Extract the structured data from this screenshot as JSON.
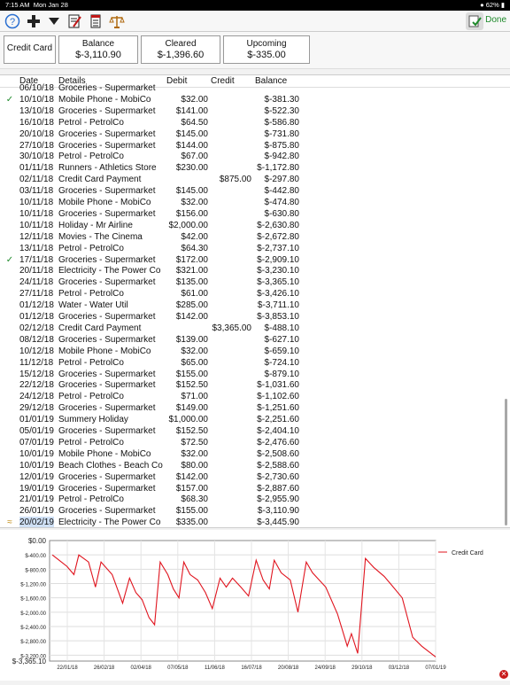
{
  "status": {
    "time": "7:15 AM",
    "date": "Mon Jan 28",
    "battery": "62%"
  },
  "toolbar": {
    "icons": [
      "help-icon",
      "add-icon",
      "filter-icon",
      "edit-icon",
      "report-icon",
      "balance-scale-icon"
    ],
    "done_label": "Done"
  },
  "summary": {
    "account": "Credit Card",
    "balance_label": "Balance",
    "balance": "$-3,110.90",
    "cleared_label": "Cleared",
    "cleared": "$-1,396.60",
    "upcoming_label": "Upcoming",
    "upcoming": "$-335.00"
  },
  "columns": {
    "date": "Date",
    "details": "Details",
    "debit": "Debit",
    "credit": "Credit",
    "balance": "Balance"
  },
  "rows": [
    {
      "mark": "",
      "date": "06/10/18",
      "details": "Groceries - Supermarket",
      "debit": "",
      "credit": "",
      "balance": ""
    },
    {
      "mark": "✓",
      "date": "10/10/18",
      "details": "Mobile Phone - MobiCo",
      "debit": "$32.00",
      "credit": "",
      "balance": "$-381.30"
    },
    {
      "mark": "",
      "date": "13/10/18",
      "details": "Groceries - Supermarket",
      "debit": "$141.00",
      "credit": "",
      "balance": "$-522.30"
    },
    {
      "mark": "",
      "date": "16/10/18",
      "details": "Petrol - PetrolCo",
      "debit": "$64.50",
      "credit": "",
      "balance": "$-586.80"
    },
    {
      "mark": "",
      "date": "20/10/18",
      "details": "Groceries - Supermarket",
      "debit": "$145.00",
      "credit": "",
      "balance": "$-731.80"
    },
    {
      "mark": "",
      "date": "27/10/18",
      "details": "Groceries - Supermarket",
      "debit": "$144.00",
      "credit": "",
      "balance": "$-875.80"
    },
    {
      "mark": "",
      "date": "30/10/18",
      "details": "Petrol - PetrolCo",
      "debit": "$67.00",
      "credit": "",
      "balance": "$-942.80"
    },
    {
      "mark": "",
      "date": "01/11/18",
      "details": "Runners - Athletics Store",
      "debit": "$230.00",
      "credit": "",
      "balance": "$-1,172.80"
    },
    {
      "mark": "",
      "date": "02/11/18",
      "details": "Credit Card Payment",
      "debit": "",
      "credit": "$875.00",
      "balance": "$-297.80"
    },
    {
      "mark": "",
      "date": "03/11/18",
      "details": "Groceries - Supermarket",
      "debit": "$145.00",
      "credit": "",
      "balance": "$-442.80"
    },
    {
      "mark": "",
      "date": "10/11/18",
      "details": "Mobile Phone - MobiCo",
      "debit": "$32.00",
      "credit": "",
      "balance": "$-474.80"
    },
    {
      "mark": "",
      "date": "10/11/18",
      "details": "Groceries - Supermarket",
      "debit": "$156.00",
      "credit": "",
      "balance": "$-630.80"
    },
    {
      "mark": "",
      "date": "10/11/18",
      "details": "Holiday - Mr Airline",
      "debit": "$2,000.00",
      "credit": "",
      "balance": "$-2,630.80"
    },
    {
      "mark": "",
      "date": "12/11/18",
      "details": "Movies - The Cinema",
      "debit": "$42.00",
      "credit": "",
      "balance": "$-2,672.80"
    },
    {
      "mark": "",
      "date": "13/11/18",
      "details": "Petrol - PetrolCo",
      "debit": "$64.30",
      "credit": "",
      "balance": "$-2,737.10"
    },
    {
      "mark": "✓",
      "date": "17/11/18",
      "details": "Groceries - Supermarket",
      "debit": "$172.00",
      "credit": "",
      "balance": "$-2,909.10"
    },
    {
      "mark": "",
      "date": "20/11/18",
      "details": "Electricity - The Power Co",
      "debit": "$321.00",
      "credit": "",
      "balance": "$-3,230.10"
    },
    {
      "mark": "",
      "date": "24/11/18",
      "details": "Groceries - Supermarket",
      "debit": "$135.00",
      "credit": "",
      "balance": "$-3,365.10"
    },
    {
      "mark": "",
      "date": "27/11/18",
      "details": "Petrol - PetrolCo",
      "debit": "$61.00",
      "credit": "",
      "balance": "$-3,426.10"
    },
    {
      "mark": "",
      "date": "01/12/18",
      "details": "Water - Water Util",
      "debit": "$285.00",
      "credit": "",
      "balance": "$-3,711.10"
    },
    {
      "mark": "",
      "date": "01/12/18",
      "details": "Groceries - Supermarket",
      "debit": "$142.00",
      "credit": "",
      "balance": "$-3,853.10"
    },
    {
      "mark": "",
      "date": "02/12/18",
      "details": "Credit Card Payment",
      "debit": "",
      "credit": "$3,365.00",
      "balance": "$-488.10"
    },
    {
      "mark": "",
      "date": "08/12/18",
      "details": "Groceries - Supermarket",
      "debit": "$139.00",
      "credit": "",
      "balance": "$-627.10"
    },
    {
      "mark": "",
      "date": "10/12/18",
      "details": "Mobile Phone - MobiCo",
      "debit": "$32.00",
      "credit": "",
      "balance": "$-659.10"
    },
    {
      "mark": "",
      "date": "11/12/18",
      "details": "Petrol - PetrolCo",
      "debit": "$65.00",
      "credit": "",
      "balance": "$-724.10"
    },
    {
      "mark": "",
      "date": "15/12/18",
      "details": "Groceries - Supermarket",
      "debit": "$155.00",
      "credit": "",
      "balance": "$-879.10"
    },
    {
      "mark": "",
      "date": "22/12/18",
      "details": "Groceries - Supermarket",
      "debit": "$152.50",
      "credit": "",
      "balance": "$-1,031.60"
    },
    {
      "mark": "",
      "date": "24/12/18",
      "details": "Petrol - PetrolCo",
      "debit": "$71.00",
      "credit": "",
      "balance": "$-1,102.60"
    },
    {
      "mark": "",
      "date": "29/12/18",
      "details": "Groceries - Supermarket",
      "debit": "$149.00",
      "credit": "",
      "balance": "$-1,251.60"
    },
    {
      "mark": "",
      "date": "01/01/19",
      "details": "Summery Holiday",
      "debit": "$1,000.00",
      "credit": "",
      "balance": "$-2,251.60"
    },
    {
      "mark": "",
      "date": "05/01/19",
      "details": "Groceries - Supermarket",
      "debit": "$152.50",
      "credit": "",
      "balance": "$-2,404.10"
    },
    {
      "mark": "",
      "date": "07/01/19",
      "details": "Petrol - PetrolCo",
      "debit": "$72.50",
      "credit": "",
      "balance": "$-2,476.60"
    },
    {
      "mark": "",
      "date": "10/01/19",
      "details": "Mobile Phone - MobiCo",
      "debit": "$32.00",
      "credit": "",
      "balance": "$-2,508.60"
    },
    {
      "mark": "",
      "date": "10/01/19",
      "details": "Beach Clothes - Beach Co",
      "debit": "$80.00",
      "credit": "",
      "balance": "$-2,588.60"
    },
    {
      "mark": "",
      "date": "12/01/19",
      "details": "Groceries - Supermarket",
      "debit": "$142.00",
      "credit": "",
      "balance": "$-2,730.60"
    },
    {
      "mark": "",
      "date": "19/01/19",
      "details": "Groceries - Supermarket",
      "debit": "$157.00",
      "credit": "",
      "balance": "$-2,887.60"
    },
    {
      "mark": "",
      "date": "21/01/19",
      "details": "Petrol - PetrolCo",
      "debit": "$68.30",
      "credit": "",
      "balance": "$-2,955.90"
    },
    {
      "mark": "",
      "date": "26/01/19",
      "details": "Groceries - Supermarket",
      "debit": "$155.00",
      "credit": "",
      "balance": "$-3,110.90"
    },
    {
      "mark": "≈",
      "date": "20/02/19",
      "details": "Electricity - The Power Co",
      "debit": "$335.00",
      "credit": "",
      "balance": "$-3,445.90",
      "selected": true
    }
  ],
  "colors": {
    "accent_green": "#1e8a2a",
    "line": "#e0141e",
    "selected_row": "#cfe0f5"
  },
  "chart_data": {
    "type": "line",
    "series": [
      {
        "name": "Credit Card",
        "color": "#e0141e"
      }
    ],
    "y_ticks": [
      "$0.00",
      "$-400.00",
      "$-800.00",
      "$-1,200.00",
      "$-1,600.00",
      "$-2,000.00",
      "$-2,400.00",
      "$-2,800.00",
      "$-3,200.00",
      "$-3,365.10"
    ],
    "x_ticks": [
      "22/01/18",
      "26/02/18",
      "02/04/18",
      "07/05/18",
      "11/06/18",
      "16/07/18",
      "20/08/18",
      "24/09/18",
      "29/10/18",
      "03/12/18",
      "07/01/19"
    ],
    "ylim": [
      -3365.1,
      0
    ],
    "x_range": [
      "2018-01-01",
      "2019-01-26"
    ],
    "grid": true,
    "legend": "top-right",
    "points": [
      [
        "2018-01-05",
        -400
      ],
      [
        "2018-01-26",
        -720
      ],
      [
        "2018-02-05",
        -950
      ],
      [
        "2018-02-12",
        -400
      ],
      [
        "2018-02-26",
        -600
      ],
      [
        "2018-03-08",
        -1300
      ],
      [
        "2018-03-16",
        -600
      ],
      [
        "2018-04-01",
        -950
      ],
      [
        "2018-04-16",
        -1750
      ],
      [
        "2018-04-26",
        -1050
      ],
      [
        "2018-05-05",
        -1450
      ],
      [
        "2018-05-14",
        -1650
      ],
      [
        "2018-05-24",
        -2150
      ],
      [
        "2018-06-01",
        -2350
      ],
      [
        "2018-06-09",
        -600
      ],
      [
        "2018-06-20",
        -950
      ],
      [
        "2018-06-28",
        -1350
      ],
      [
        "2018-07-06",
        -1600
      ],
      [
        "2018-07-13",
        -600
      ],
      [
        "2018-07-22",
        -950
      ],
      [
        "2018-08-02",
        -1100
      ],
      [
        "2018-08-13",
        -1450
      ],
      [
        "2018-08-23",
        -1900
      ],
      [
        "2018-09-03",
        -1050
      ],
      [
        "2018-09-12",
        -1300
      ],
      [
        "2018-09-21",
        -1050
      ],
      [
        "2018-10-03",
        -1300
      ],
      [
        "2018-10-14",
        -1550
      ],
      [
        "2018-10-25",
        -550
      ],
      [
        "2018-11-04",
        -1100
      ],
      [
        "2018-11-13",
        -1350
      ],
      [
        "2018-11-20",
        -550
      ],
      [
        "2018-11-30",
        -900
      ],
      [
        "2018-12-13",
        -1100
      ],
      [
        "2018-12-24",
        -2000
      ],
      [
        "2019-01-05",
        -600
      ],
      [
        "2019-01-14",
        -900
      ],
      [
        "2019-02-02",
        -1300
      ],
      [
        "2019-02-19",
        -2050
      ],
      [
        "2019-03-05",
        -2950
      ],
      [
        "2019-03-11",
        -2600
      ],
      [
        "2019-03-20",
        -3150
      ],
      [
        "2019-03-31",
        -500
      ],
      [
        "2019-04-12",
        -750
      ],
      [
        "2019-04-27",
        -1000
      ],
      [
        "2019-05-08",
        -1250
      ],
      [
        "2019-05-23",
        -1600
      ],
      [
        "2019-06-07",
        -2700
      ],
      [
        "2019-06-20",
        -2950
      ],
      [
        "2019-07-10",
        -3250
      ]
    ]
  }
}
